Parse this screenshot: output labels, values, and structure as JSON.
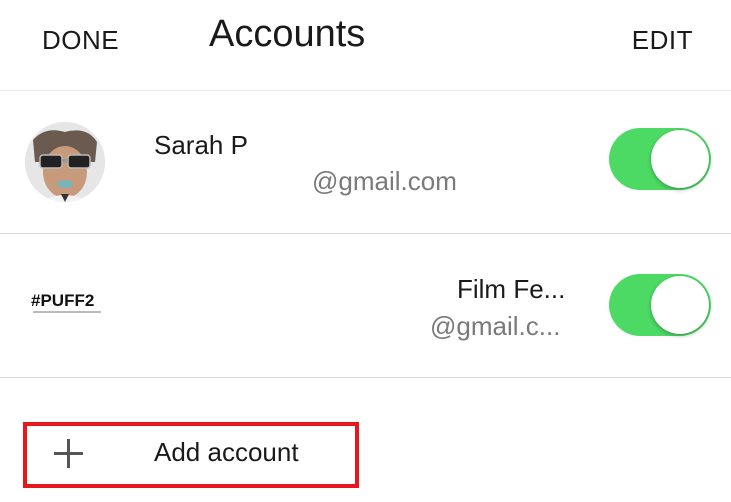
{
  "header": {
    "done_label": "DONE",
    "title": "Accounts",
    "edit_label": "EDIT"
  },
  "accounts": [
    {
      "name": "Sarah P",
      "email": "@gmail.com",
      "enabled": true,
      "avatar": "profile-photo"
    },
    {
      "name": "Film Fe...",
      "email": "@gmail.c...",
      "enabled": true,
      "avatar": "#PUFF2-logo",
      "logo_text": "#PUFF2"
    }
  ],
  "add_account": {
    "label": "Add account",
    "icon": "plus-icon"
  },
  "colors": {
    "toggle_on": "#4cd964",
    "highlight_border": "#e8171d",
    "secondary_text": "#7a7a7a"
  }
}
